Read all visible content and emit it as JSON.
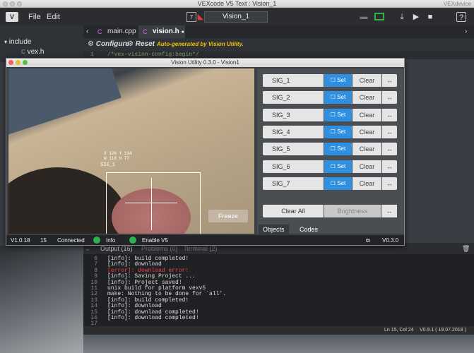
{
  "mac_window": {
    "title": "VEXcode V5 Text : Vision_1",
    "right_text": "VEXdevice"
  },
  "menubar": {
    "logo": "V",
    "file": "File",
    "edit": "Edit",
    "project_name": "Vision_1"
  },
  "sidebar": {
    "folder": "include",
    "file": "vex.h"
  },
  "editor": {
    "tabs": [
      {
        "label": "main.cpp"
      },
      {
        "label": "vision.h",
        "modified": "●"
      }
    ],
    "toolbar": {
      "configure": "Configure",
      "reset": "Reset",
      "auto_note": "Auto-generated by Vision Utility."
    },
    "line1_number": "1",
    "line1_text": "/*vex-vision-config:begin*/"
  },
  "vision_utility": {
    "title": "Vision Utility 0.3.0 - Vision1",
    "camera": {
      "coords_line1": "X 126 Y 134",
      "coords_line2": "W 118 H 77",
      "sig_label": "SIG_1",
      "freeze_label": "Freeze"
    },
    "signatures": [
      {
        "name": "SIG_1",
        "set": "Set",
        "clear": "Clear",
        "arrow": "↔"
      },
      {
        "name": "SIG_2",
        "set": "Set",
        "clear": "Clear",
        "arrow": "↔"
      },
      {
        "name": "SIG_3",
        "set": "Set",
        "clear": "Clear",
        "arrow": "↔"
      },
      {
        "name": "SIG_4",
        "set": "Set",
        "clear": "Clear",
        "arrow": "↔"
      },
      {
        "name": "SIG_5",
        "set": "Set",
        "clear": "Clear",
        "arrow": "↔"
      },
      {
        "name": "SIG_6",
        "set": "Set",
        "clear": "Clear",
        "arrow": "↔"
      },
      {
        "name": "SIG_7",
        "set": "Set",
        "clear": "Clear",
        "arrow": "↔"
      }
    ],
    "clear_all": "Clear All",
    "brightness": "Brightness",
    "brightness_arrow": "↔",
    "panel_tabs": {
      "objects": "Objects",
      "codes": "Codes"
    },
    "status": {
      "firmware": "V1.0.18",
      "fps": "15",
      "connection": "Connected",
      "info": "Info",
      "enable": "Enable V5",
      "version": "V0.3.0"
    }
  },
  "output_panel": {
    "tabs": {
      "output": "Output (16)",
      "problems": "Problems (0)",
      "terminal": "Terminal (2)"
    },
    "lines": [
      {
        "n": "6",
        "text": "[info]: build completed!"
      },
      {
        "n": "7",
        "text": "[info]: download"
      },
      {
        "n": "8",
        "text": "[error]: download error!",
        "error": true
      },
      {
        "n": "9",
        "text": "[info]: Saving Project ..."
      },
      {
        "n": "10",
        "text": "[info]: Project saved!"
      },
      {
        "n": "11",
        "text": "unix build for platform vexv5"
      },
      {
        "n": "12",
        "text": "make: Nothing to be done for `all'."
      },
      {
        "n": "13",
        "text": "[info]: build completed!"
      },
      {
        "n": "14",
        "text": "[info]: download"
      },
      {
        "n": "15",
        "text": "[info]: download completed!"
      },
      {
        "n": "16",
        "text": "[info]: download completed!"
      },
      {
        "n": "17",
        "text": ""
      }
    ]
  },
  "statusbar": {
    "position": "Ln 15, Col 24",
    "version": "V0.9.1 ( 19.07.2018 )"
  }
}
